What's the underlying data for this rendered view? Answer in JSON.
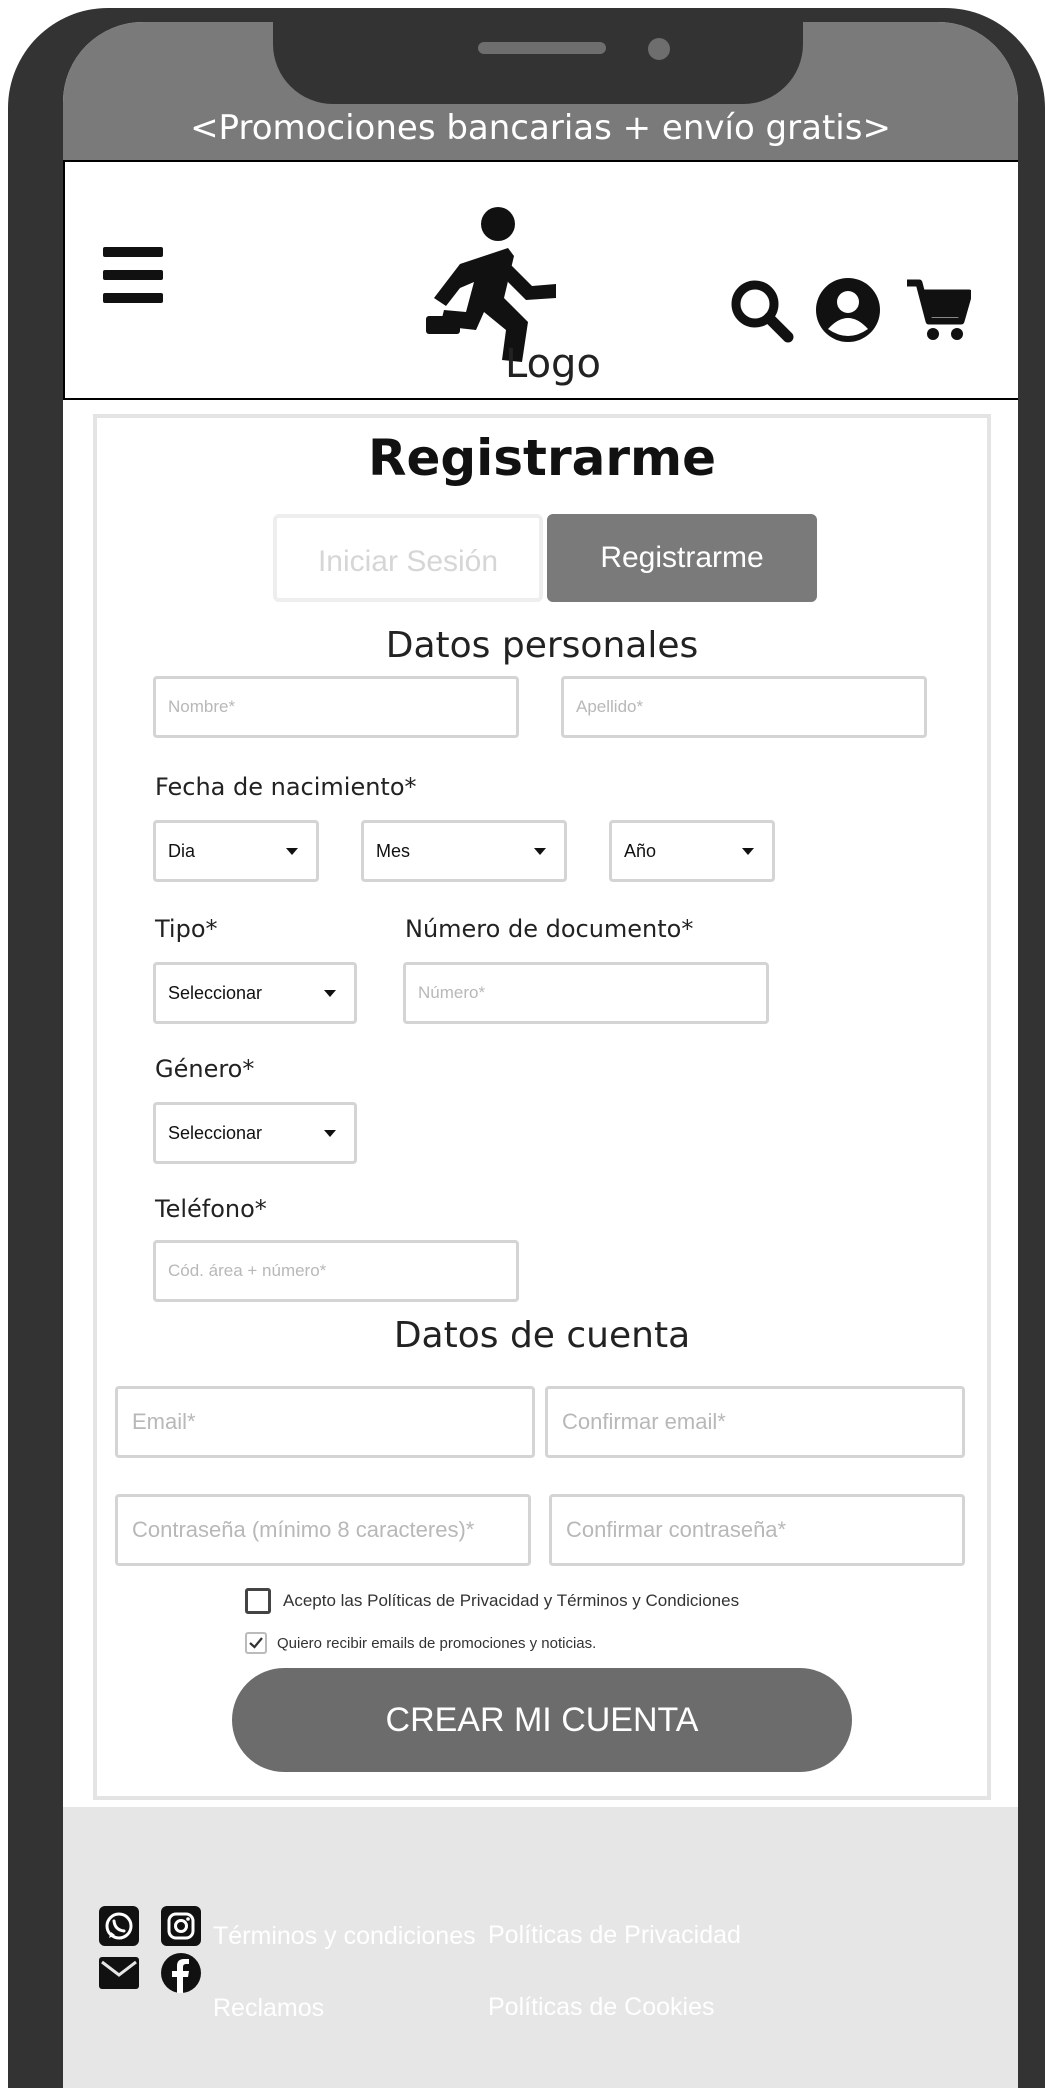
{
  "promo": {
    "text": "<Promociones bancarias + envío gratis>"
  },
  "header": {
    "logo_label": "Logo",
    "icons": [
      "hamburger-menu-icon",
      "running-person-logo-icon",
      "search-icon",
      "user-account-icon",
      "shopping-cart-icon"
    ]
  },
  "form": {
    "title": "Registrarme",
    "tabs": {
      "login": "Iniciar Sesión",
      "register": "Registrarme",
      "active": "register"
    },
    "personal": {
      "title": "Datos personales",
      "nombre_placeholder": "Nombre*",
      "apellido_placeholder": "Apellido*",
      "birth_label": "Fecha de nacimiento*",
      "dia": "Dia",
      "mes": "Mes",
      "anio": "Año",
      "tipo_label": "Tipo*",
      "tipo_value": "Seleccionar",
      "doc_label": "Número de documento*",
      "doc_placeholder": "Número*",
      "genero_label": "Género*",
      "genero_value": "Seleccionar",
      "telefono_label": "Teléfono*",
      "telefono_placeholder": "Cód. área + número*"
    },
    "account": {
      "title": "Datos de cuenta",
      "email_placeholder": "Email*",
      "confirm_email_placeholder": "Confirmar email*",
      "password_placeholder": "Contraseña (mínimo 8 caracteres)*",
      "confirm_password_placeholder": "Confirmar contraseña*"
    },
    "terms": {
      "label": "Acepto las Políticas de Privacidad y Términos y Condiciones",
      "checked": false
    },
    "newsletter": {
      "label": "Quiero recibir emails de promociones y noticias.",
      "checked": true
    },
    "submit_label": "CREAR MI CUENTA"
  },
  "footer": {
    "links": {
      "terminos": "Términos y condiciones",
      "privacidad": "Políticas de Privacidad",
      "reclamos": "Reclamos",
      "cookies": "Políticas de Cookies"
    },
    "social_icons": [
      "whatsapp-icon",
      "instagram-icon",
      "email-icon",
      "facebook-icon"
    ]
  },
  "colors": {
    "frame": "#333333",
    "promo_bg": "#7a7a7a",
    "primary_button": "#6c6c6c",
    "footer_bg": "#e6e6e6"
  }
}
